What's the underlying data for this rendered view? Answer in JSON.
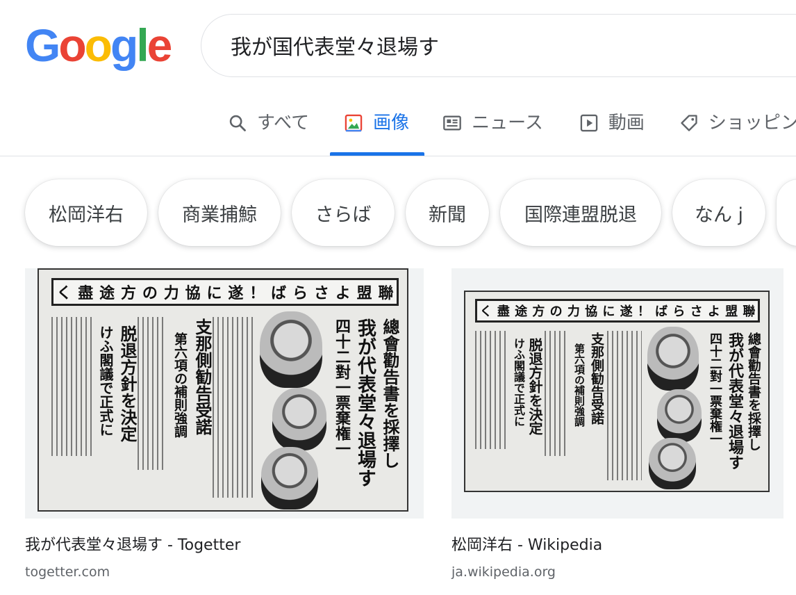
{
  "logo": {
    "letters": [
      "G",
      "o",
      "o",
      "g",
      "l",
      "e"
    ],
    "colors": [
      "#4285F4",
      "#EA4335",
      "#FBBC05",
      "#4285F4",
      "#34A853",
      "#EA4335"
    ]
  },
  "search": {
    "query": "我が国代表堂々退場す"
  },
  "tabs": [
    {
      "label": "すべて",
      "icon": "search-icon"
    },
    {
      "label": "画像",
      "icon": "image-icon",
      "active": true
    },
    {
      "label": "ニュース",
      "icon": "news-icon"
    },
    {
      "label": "動画",
      "icon": "play-icon"
    },
    {
      "label": "ショッピング",
      "icon": "tag-icon"
    }
  ],
  "chips": [
    "松岡洋右",
    "商業捕鯨",
    "さらば",
    "新聞",
    "国際連盟脱退",
    "なん j"
  ],
  "results": [
    {
      "title": "我が代表堂々退場す - Togetter",
      "site": "togetter.com"
    },
    {
      "title": "松岡洋右 - Wikipedia",
      "site": "ja.wikipedia.org"
    }
  ],
  "newspaper": {
    "headline": [
      "聯",
      "盟",
      "よ",
      "さ",
      "ら",
      "ば",
      "！",
      "遂",
      "に",
      "協",
      "力",
      "の",
      "方",
      "途",
      "盡",
      "く"
    ],
    "main_headline": "我が代表堂々退場す",
    "sub_headline": "總會勸告書を採擇し",
    "vote": "四十二對一票棄権一",
    "left_headline": "脱退方針を決定",
    "left_sub": "けふ閣議で正式に",
    "mid_headline": "支那側勧告受諾",
    "mid_sub": "第六項の補則強調"
  },
  "accent": "#1a73e8"
}
